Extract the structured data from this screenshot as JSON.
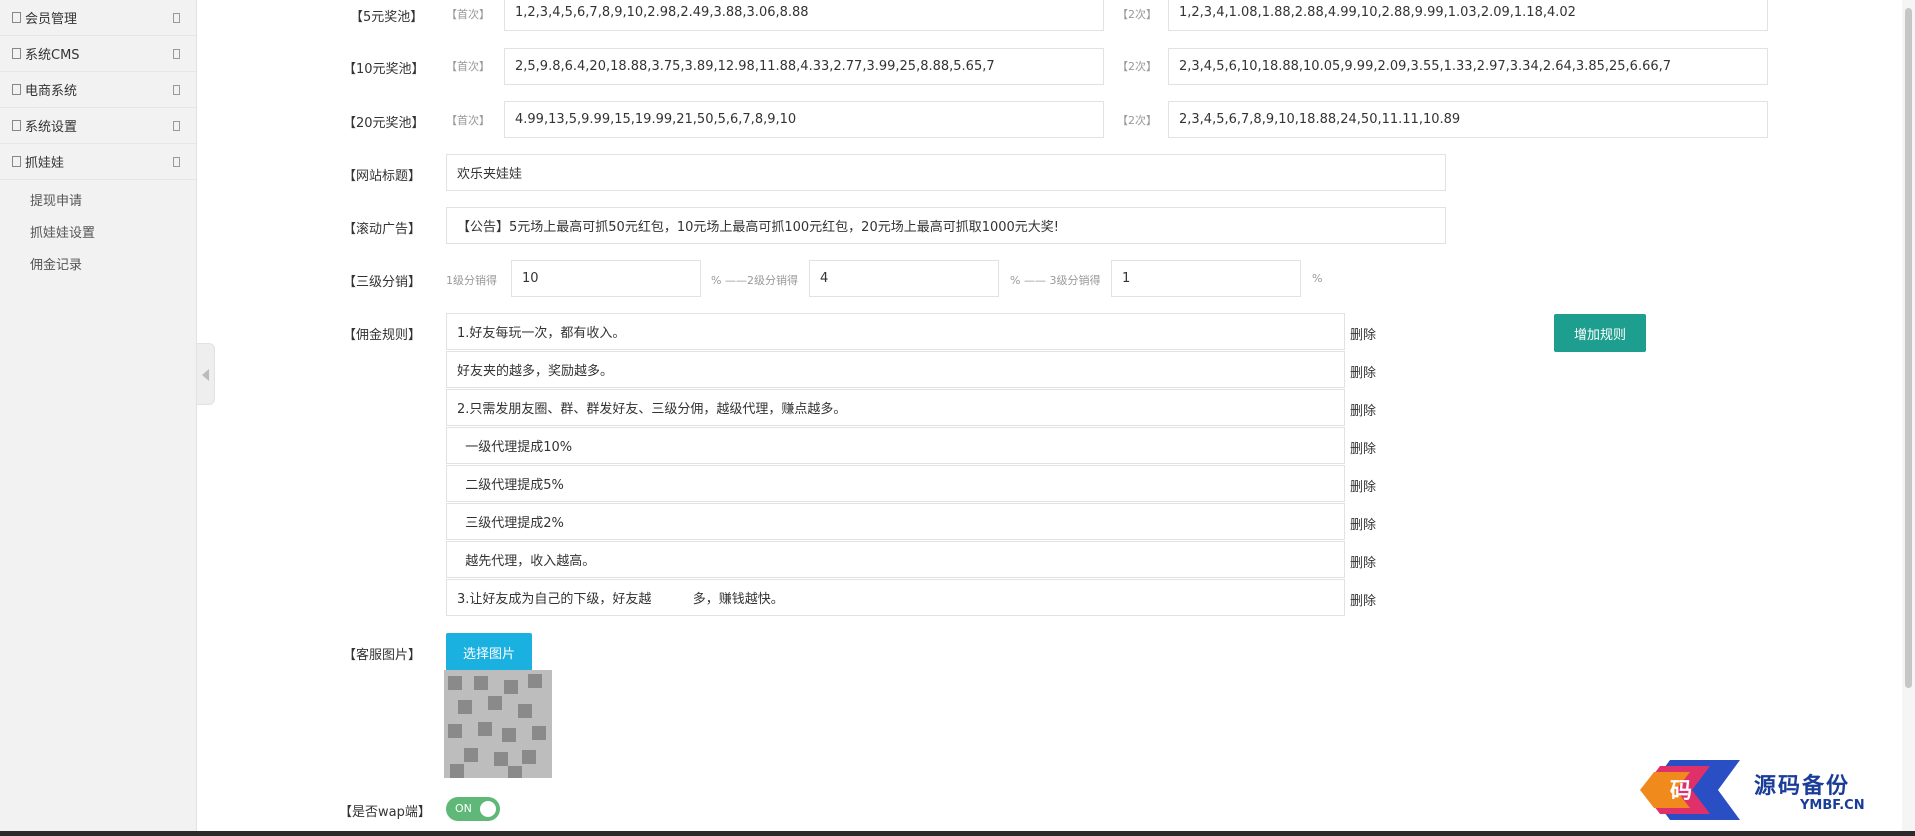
{
  "sidebar": {
    "menu": [
      {
        "label": "会员管理"
      },
      {
        "label": "系统CMS"
      },
      {
        "label": "电商系统"
      },
      {
        "label": "系统设置"
      },
      {
        "label": "抓娃娃"
      }
    ],
    "submenu": [
      {
        "label": "提现申请"
      },
      {
        "label": "抓娃娃设置"
      },
      {
        "label": "佣金记录"
      }
    ]
  },
  "form": {
    "pools": [
      {
        "label": "【5元奖池】",
        "first_tag": "【首次】",
        "first_value": "1,2,3,4,5,6,7,8,9,10,2.98,2.49,3.88,3.06,8.88",
        "second_tag": "【2次】",
        "second_value": "1,2,3,4,1.08,1.88,2.88,4.99,10,2.88,9.99,1.03,2.09,1.18,4.02"
      },
      {
        "label": "【10元奖池】",
        "first_tag": "【首次】",
        "first_value": "2,5,9.8,6.4,20,18.88,3.75,3.89,12.98,11.88,4.33,2.77,3.99,25,8.88,5.65,7",
        "second_tag": "【2次】",
        "second_value": "2,3,4,5,6,10,18.88,10.05,9.99,2.09,3.55,1.33,2.97,3.34,2.64,3.85,25,6.66,7"
      },
      {
        "label": "【20元奖池】",
        "first_tag": "【首次】",
        "first_value": "4.99,13,5,9.99,15,19.99,21,50,5,6,7,8,9,10",
        "second_tag": "【2次】",
        "second_value": "2,3,4,5,6,7,8,9,10,18.88,24,50,11.11,10.89"
      }
    ],
    "site_title": {
      "label": "【网站标题】",
      "value": "欢乐夹娃娃"
    },
    "scroll_ad": {
      "label": "【滚动广告】",
      "value": "【公告】5元场上最高可抓50元红包，10元场上最高可抓100元红包，20元场上最高可抓取1000元大奖!"
    },
    "distribution": {
      "label": "【三级分销】",
      "l1_tag": "1级分销得",
      "l1_value": "10",
      "l2_tag": "% ——2级分销得",
      "l2_value": "4",
      "l3_tag": "% —— 3级分销得",
      "l3_value": "1",
      "suffix": "%"
    },
    "commission": {
      "label": "【佣金规则】",
      "delete_label": "删除",
      "add_button": "增加规则",
      "rules": [
        "1.好友每玩一次，都有收入。",
        "好友夹的越多，奖励越多。",
        "2.只需发朋友圈、群、群发好友、三级分佣，越级代理，赚点越多。",
        "  一级代理提成10%",
        "  二级代理提成5%",
        "  三级代理提成2%",
        "  越先代理，收入越高。",
        "3.让好友成为自己的下级，好友越          多，赚钱越快。"
      ]
    },
    "service_image": {
      "label": "【客服图片】",
      "button": "选择图片"
    },
    "wap": {
      "label": "【是否wap端】",
      "toggle_text": "ON",
      "enabled": true
    }
  },
  "watermark": {
    "cn": "源码备份",
    "en": "YMBF.CN"
  },
  "colors": {
    "teal": "#1e9e8e",
    "blue": "#1ab0e0",
    "switch_on": "#5fb878"
  }
}
